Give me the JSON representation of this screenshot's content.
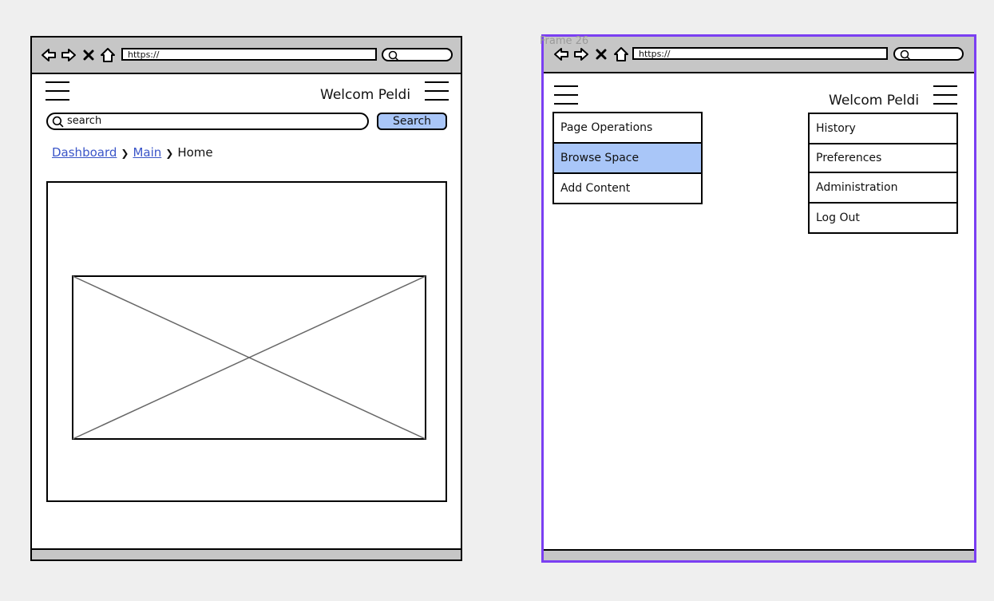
{
  "frame_label": "Frame 26",
  "browser": {
    "url": "https://"
  },
  "left_screen": {
    "welcome": "Welcom Peldi",
    "search": {
      "placeholder": "search",
      "button": "Search"
    },
    "breadcrumb": [
      {
        "label": "Dashboard",
        "link": true
      },
      {
        "label": "Main",
        "link": true
      },
      {
        "label": "Home",
        "link": false
      }
    ]
  },
  "right_screen": {
    "welcome": "Welcom Peldi",
    "left_menu": [
      {
        "label": "Page Operations",
        "active": false
      },
      {
        "label": "Browse Space",
        "active": true
      },
      {
        "label": "Add Content",
        "active": false
      }
    ],
    "right_menu": [
      {
        "label": "History"
      },
      {
        "label": "Preferences"
      },
      {
        "label": "Administration"
      },
      {
        "label": "Log Out"
      }
    ]
  },
  "colors": {
    "accent": "#a9c6f8",
    "link": "#3a55c8",
    "frame_selected": "#7b3ff2",
    "chrome": "#c6c6c6",
    "background": "#efefef"
  },
  "icons": [
    "back-arrow-icon",
    "forward-arrow-icon",
    "close-icon",
    "home-icon",
    "search-icon",
    "hamburger-menu-icon",
    "image-placeholder-icon"
  ]
}
